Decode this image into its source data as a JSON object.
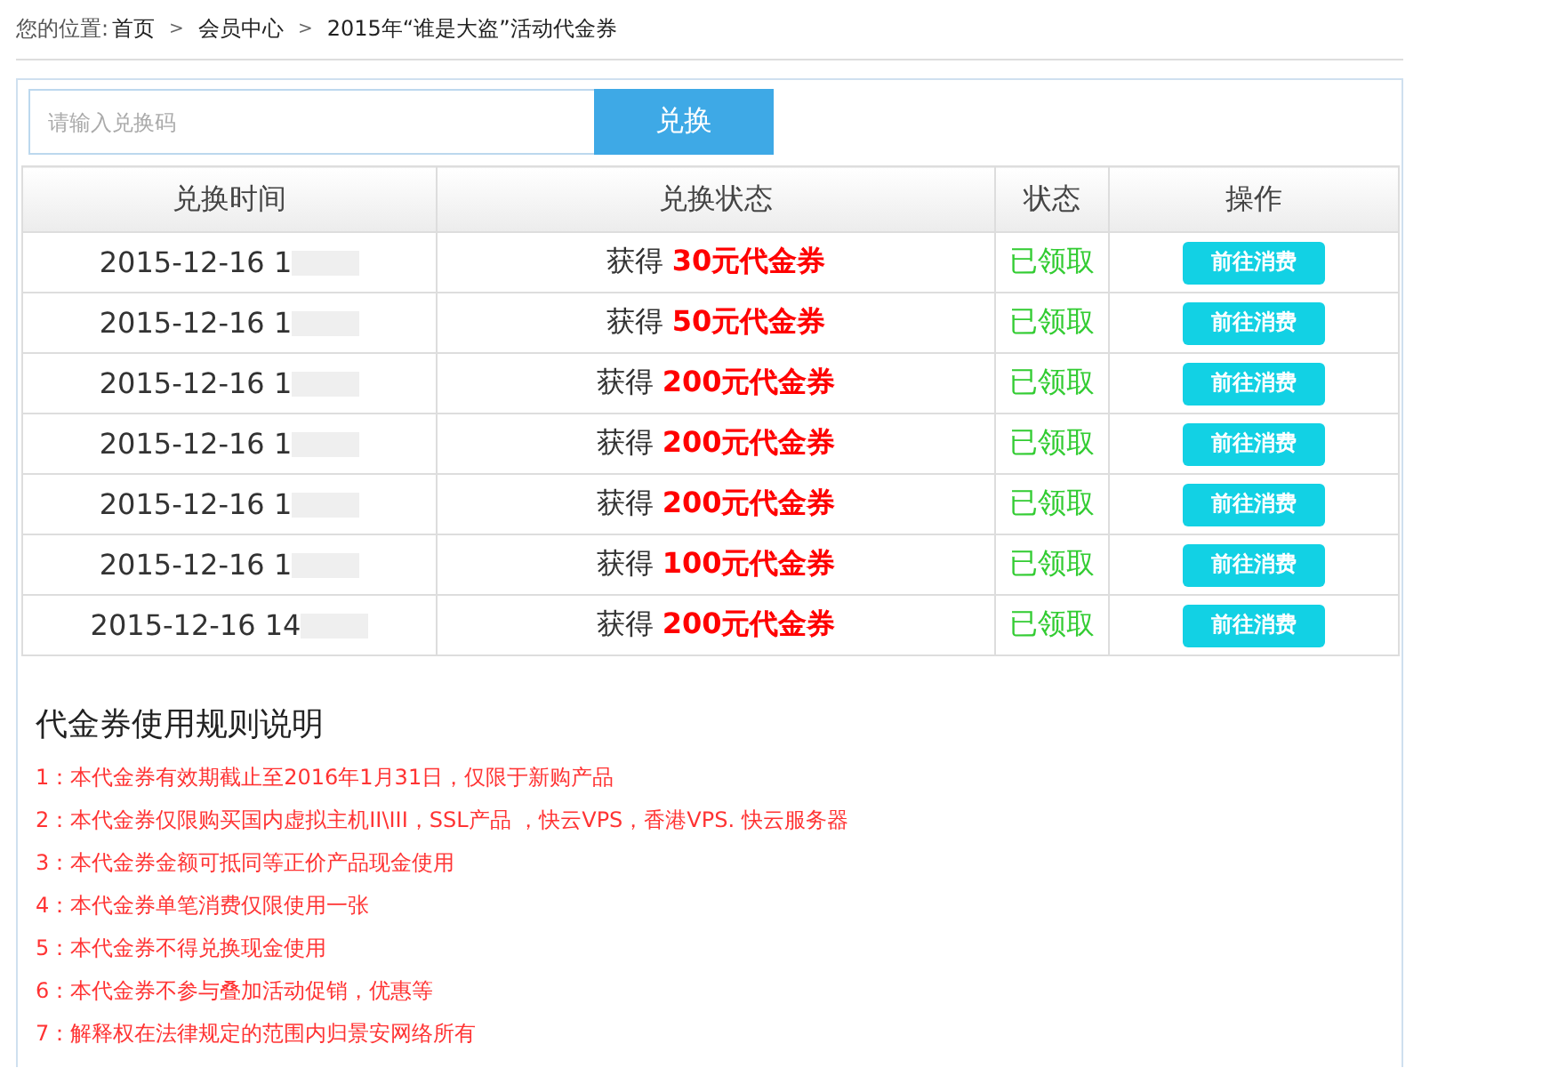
{
  "breadcrumb": {
    "label": "您的位置:",
    "items": [
      {
        "text": "首页",
        "separator": ">"
      },
      {
        "text": "会员中心",
        "separator": ">"
      },
      {
        "text": "2015年“谁是大盗”活动代金券"
      }
    ]
  },
  "redeem": {
    "placeholder": "请输入兑换码",
    "button": "兑换"
  },
  "table": {
    "columns": [
      "兑换时间",
      "兑换状态",
      "状态",
      "操作"
    ],
    "rows": [
      {
        "time": "2015-12-16 1",
        "result": "获得 **30元代金券**",
        "status": "已领取",
        "action": "前往消费"
      },
      {
        "time": "2015-12-16 1",
        "result": "获得 **50元代金券**",
        "status": "已领取",
        "action": "前往消费"
      },
      {
        "time": "2015-12-16 1",
        "result": "获得 **200元代金券**",
        "status": "已领取",
        "action": "前往消费"
      },
      {
        "time": "2015-12-16 1",
        "result": "获得 **200元代金券**",
        "status": "已领取",
        "action": "前往消费"
      },
      {
        "time": "2015-12-16 1",
        "result": "获得 **200元代金券**",
        "status": "已领取",
        "action": "前往消费"
      },
      {
        "time": "2015-12-16 1",
        "result": "获得 **100元代金券**",
        "status": "已领取",
        "action": "前往消费"
      },
      {
        "time": "2015-12-16 14",
        "result": "获得 **200元代金券**",
        "status": "已领取",
        "action": "前往消费"
      }
    ]
  },
  "rules": {
    "title": "代金券使用规则说明",
    "items": [
      "1：本代金券有效期截止至2016年1月31日，仅限于新购产品",
      "2：本代金券仅限购买国内虚拟主机II\\III，SSL产品 ，快云VPS，香港VPS. 快云服务器",
      "3：本代金券金额可抵同等正价产品现金使用",
      "4：本代金券单笔消费仅限使用一张",
      "5：本代金券不得兑换现金使用",
      "6：本代金券不参与叠加活动促销，优惠等",
      "7：解释权在法律规定的范围内归景安网络所有"
    ]
  }
}
